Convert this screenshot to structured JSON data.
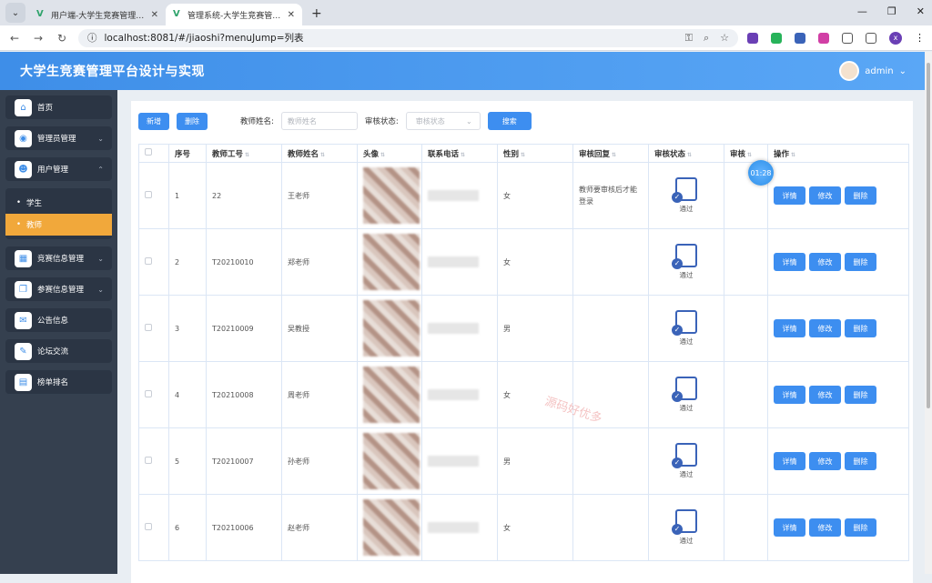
{
  "browser": {
    "tabs": [
      {
        "title": "用户端-大学生竞赛管理平台设计",
        "active": false
      },
      {
        "title": "管理系统-大学生竞赛管理平台设计",
        "active": true
      }
    ],
    "url": "localhost:8081/#/jiaoshi?menuJump=列表"
  },
  "header": {
    "title": "大学生竞赛管理平台设计与实现",
    "user": "admin"
  },
  "sidebar": {
    "items": [
      {
        "label": "首页",
        "icon": "home-icon"
      },
      {
        "label": "管理员管理",
        "icon": "admin-icon",
        "expandable": true
      },
      {
        "label": "用户管理",
        "icon": "user-icon",
        "expandable": true
      },
      {
        "label": "竞赛信息管理",
        "icon": "grid-icon",
        "expandable": true
      },
      {
        "label": "参赛信息管理",
        "icon": "copy-icon",
        "expandable": true
      },
      {
        "label": "公告信息",
        "icon": "mail-icon"
      },
      {
        "label": "论坛交流",
        "icon": "chat-icon"
      },
      {
        "label": "榜单排名",
        "icon": "rank-icon"
      }
    ],
    "sub_items": [
      {
        "label": "学生",
        "active": false
      },
      {
        "label": "教师",
        "active": true
      }
    ]
  },
  "toolbar": {
    "add_label": "新增",
    "delete_label": "删除",
    "name_label": "教师姓名:",
    "name_placeholder": "教师姓名",
    "status_label": "审核状态:",
    "status_placeholder": "审核状态",
    "search_label": "搜索"
  },
  "table": {
    "columns": [
      "序号",
      "教师工号",
      "教师姓名",
      "头像",
      "联系电话",
      "性别",
      "审核回复",
      "审核状态",
      "审核",
      "操作"
    ],
    "rows": [
      {
        "index": "1",
        "id": "22",
        "name": "王老师",
        "gender": "女",
        "reply": "教师要审核后才能登录",
        "status": "通过"
      },
      {
        "index": "2",
        "id": "T20210010",
        "name": "郑老师",
        "gender": "女",
        "reply": "",
        "status": "通过"
      },
      {
        "index": "3",
        "id": "T20210009",
        "name": "吴教授",
        "gender": "男",
        "reply": "",
        "status": "通过"
      },
      {
        "index": "4",
        "id": "T20210008",
        "name": "周老师",
        "gender": "女",
        "reply": "",
        "status": "通过"
      },
      {
        "index": "5",
        "id": "T20210007",
        "name": "孙老师",
        "gender": "男",
        "reply": "",
        "status": "通过"
      },
      {
        "index": "6",
        "id": "T20210006",
        "name": "赵老师",
        "gender": "女",
        "reply": "",
        "status": "通过"
      }
    ],
    "actions": {
      "detail": "详情",
      "edit": "修改",
      "delete": "删除"
    }
  },
  "timer": "01:28",
  "watermark": "源码好优多"
}
